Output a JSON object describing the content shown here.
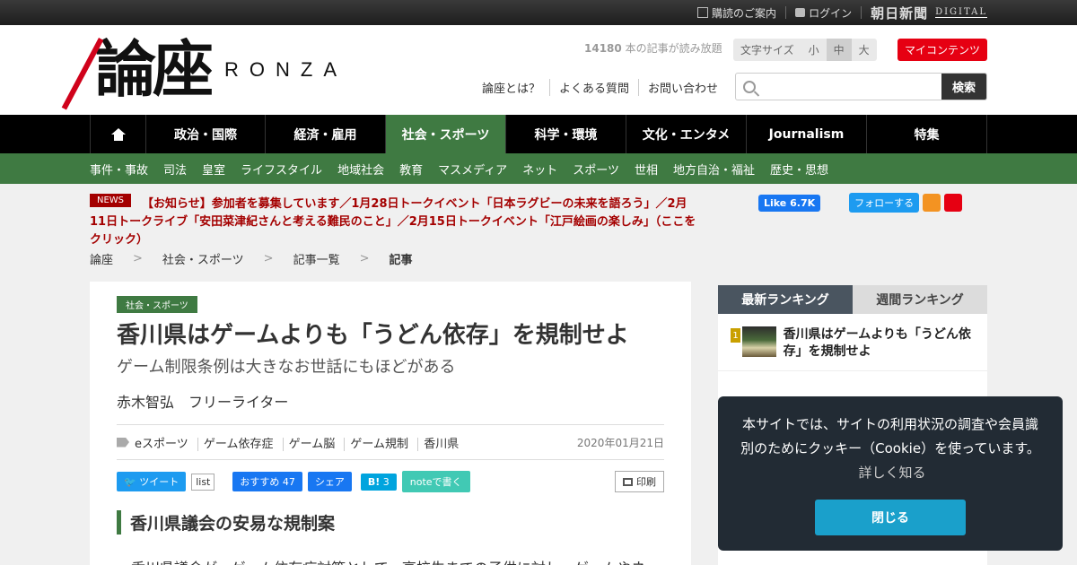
{
  "topbar": {
    "subscribe": "購読のご案内",
    "login": "ログイン",
    "brand": "朝日新聞",
    "brand_sub": "DIGITAL"
  },
  "header": {
    "logo_kanji": "論座",
    "logo_roman": "RONZA",
    "counter_number": "14180",
    "counter_text": "本の記事が読み放題",
    "fontsize_label": "文字サイズ",
    "fontsize_small": "小",
    "fontsize_medium": "中",
    "fontsize_large": "大",
    "mycontents": "マイコンテンツ",
    "links": [
      "論座とは？",
      "よくある質問",
      "お問い合わせ"
    ],
    "search_placeholder": "",
    "search_button": "検索"
  },
  "mainnav": [
    "政治・国際",
    "経済・雇用",
    "社会・スポーツ",
    "科学・環境",
    "文化・エンタメ",
    "Journalism",
    "特集"
  ],
  "subnav": [
    "事件・事故",
    "司法",
    "皇室",
    "ライフスタイル",
    "地域社会",
    "教育",
    "マスメディア",
    "ネット",
    "スポーツ",
    "世相",
    "地方自治・福祉",
    "歴史・思想"
  ],
  "news": {
    "badge": "NEWS",
    "text": "【お知らせ】参加者を募集しています／1月28日トークイベント「日本ラグビーの未来を語ろう」／2月11日トークライブ「安田菜津紀さんと考える難民のこと」／2月15日トークイベント「江戸絵画の楽しみ」（ここをクリック）"
  },
  "social": {
    "fb_like": "Like",
    "fb_count": "6.7K",
    "tw_follow": "フォローする"
  },
  "breadcrumb": [
    "論座",
    "社会・スポーツ",
    "記事一覧",
    "記事"
  ],
  "article": {
    "category": "社会・スポーツ",
    "title": "香川県はゲームよりも「うどん依存」を規制せよ",
    "subtitle": "ゲーム制限条例は大きなお世話にもほどがある",
    "author": "赤木智弘　フリーライター",
    "tags": [
      "eスポーツ",
      "ゲーム依存症",
      "ゲーム脳",
      "ゲーム規制",
      "香川県"
    ],
    "date": "2020年01月21日",
    "share": {
      "tweet": "ツイート",
      "list": "list",
      "fb_recommend": "おすすめ",
      "fb_count": "47",
      "fb_share": "シェア",
      "hatena": "B!",
      "hatena_count": "3",
      "note": "noteで書く",
      "print": "印刷"
    },
    "heading": "香川県議会の安易な規制案",
    "paragraph": "香川県議会が、ゲーム依存症対策として、高校生までの子供に対し、ゲームやネッ"
  },
  "ranking": {
    "tab_latest": "最新ランキング",
    "tab_weekly": "週間ランキング",
    "items": [
      {
        "rank": "1",
        "title": "香川県はゲームよりも「うどん依存」を規制せよ"
      }
    ]
  },
  "cookie": {
    "text": "本サイトでは、サイトの利用状況の調査や会員識別のためにクッキー（Cookie）を使っています。",
    "more": "詳しく知る",
    "close": "閉じる"
  }
}
